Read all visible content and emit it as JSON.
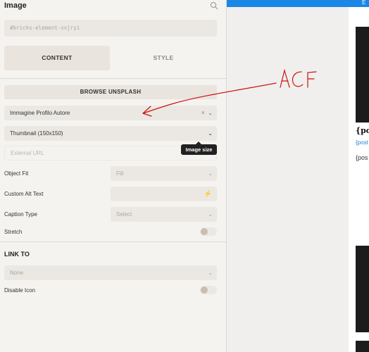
{
  "panel": {
    "title": "Image",
    "element_id": "#bricks-element-svjryi",
    "tabs": [
      {
        "label": "CONTENT",
        "active": true
      },
      {
        "label": "STYLE",
        "active": false
      }
    ],
    "browse_button": "BROWSE UNSPLASH",
    "image_source": {
      "value": "Immagine Profilo Autore",
      "clear_icon": "×"
    },
    "image_size": {
      "value": "Thumbnail (150x150)",
      "tooltip": "Image size"
    },
    "external_url": {
      "placeholder": "External URL"
    },
    "object_fit": {
      "label": "Object Fit",
      "value": "Fill"
    },
    "custom_alt": {
      "label": "Custom Alt Text"
    },
    "caption_type": {
      "label": "Caption Type",
      "value": "Select"
    },
    "stretch": {
      "label": "Stretch",
      "on": false
    },
    "link_to": {
      "title": "LINK TO",
      "value": "None",
      "disable_icon_label": "Disable Icon",
      "disable_icon_on": false
    }
  },
  "annotation": {
    "text": "ACF",
    "color": "#cc1111"
  },
  "preview": {
    "top_bar_text": "E",
    "heading": "{pos",
    "link": "{post",
    "text": "{pos",
    "accent": "#1a86e6"
  }
}
